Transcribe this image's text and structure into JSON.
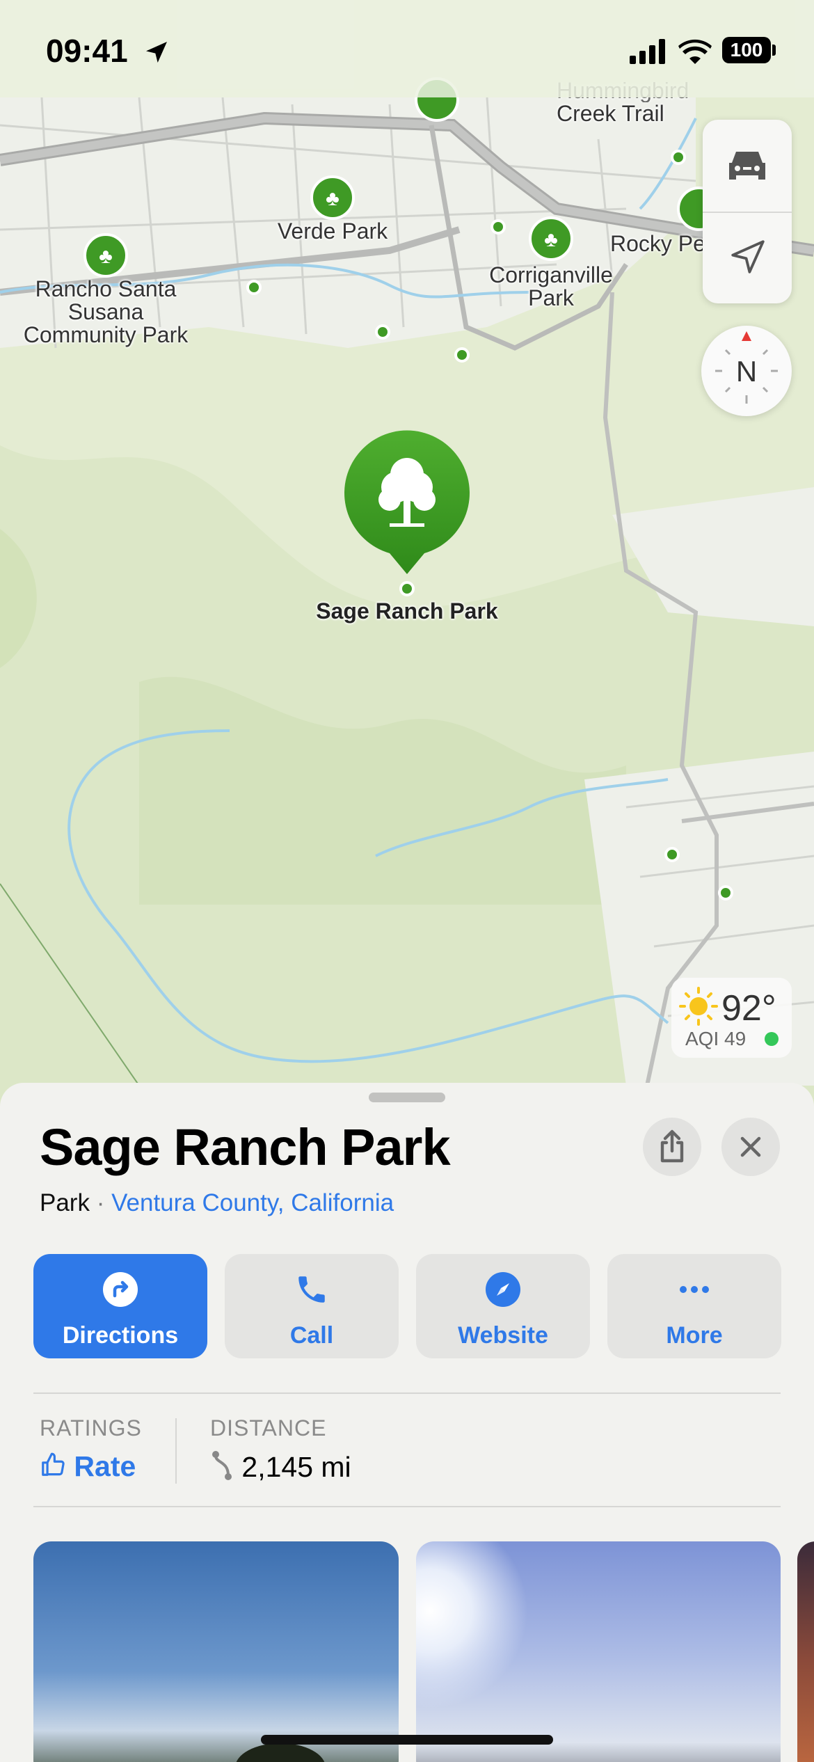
{
  "status_bar": {
    "time": "09:41",
    "battery": "100",
    "icons": [
      "location-arrow-icon",
      "signal-icon",
      "wifi-icon",
      "battery-icon"
    ]
  },
  "map": {
    "labels": {
      "hummingbird": "Hummingbird\nCreek Trail",
      "verde": "Verde Park",
      "rancho": [
        "Rancho Santa",
        "Susana",
        "Community Park"
      ],
      "corriganville": [
        "Corriganville",
        "Park"
      ],
      "rocky": "Rocky Pe",
      "selected": "Sage Ranch Park"
    },
    "controls": {
      "transport_icon": "car-icon",
      "locate_icon": "location-arrow-icon",
      "compass": "N"
    },
    "weather": {
      "temperature": "92°",
      "aqi": "AQI 49",
      "aqi_color": "#34c759",
      "icon": "sun-icon"
    },
    "colors": {
      "park_green": "#3f9a25",
      "water": "#9fd0ea",
      "terrain": "#e3ecd0"
    }
  },
  "place": {
    "title": "Sage Ranch Park",
    "category": "Park",
    "separator": "·",
    "location": "Ventura County, California",
    "actions": [
      {
        "label": "Directions",
        "icon": "turn-right-arrow-icon",
        "primary": true
      },
      {
        "label": "Call",
        "icon": "phone-icon"
      },
      {
        "label": "Website",
        "icon": "compass-icon"
      },
      {
        "label": "More",
        "icon": "ellipsis-icon"
      }
    ],
    "ratings": {
      "label": "RATINGS",
      "action": "Rate"
    },
    "distance": {
      "label": "DISTANCE",
      "value": "2,145 mi"
    },
    "accent": "#2f79e8"
  }
}
